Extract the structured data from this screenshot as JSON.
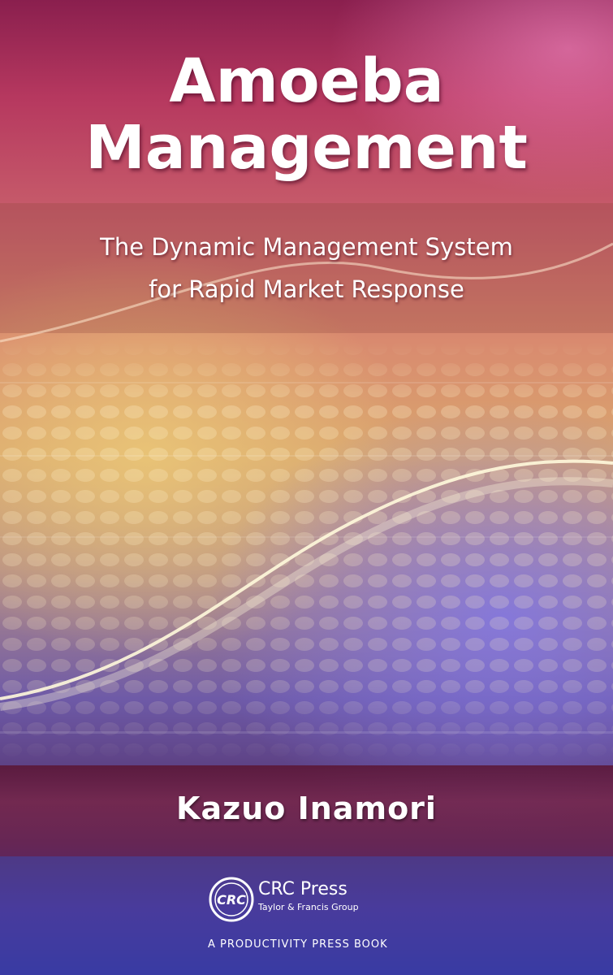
{
  "cover": {
    "title_line1": "Amoeba",
    "title_line2": "Management",
    "subtitle_line1": "The Dynamic Management System",
    "subtitle_line2": "for Rapid Market Response",
    "author": "Kazuo Inamori"
  },
  "publisher": {
    "logo_text": "CRC",
    "name": "CRC Press",
    "group": "Taylor & Francis Group",
    "imprint": "A PRODUCTIVITY PRESS BOOK"
  },
  "colors": {
    "top": "#8a1f4e",
    "middle": "#d9a66e",
    "lower": "#6e5aa7",
    "text": "#ffffff"
  }
}
